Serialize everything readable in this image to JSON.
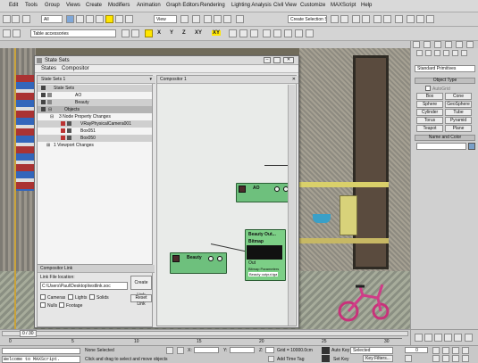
{
  "menu": [
    "Edit",
    "Tools",
    "Group",
    "Views",
    "Create",
    "Modifiers",
    "Animation",
    "Graph Editors",
    "Rendering",
    "Lighting Analysis",
    "Civil View",
    "Customize",
    "MAXScript",
    "Help"
  ],
  "toolbar": {
    "selection_filter": "All",
    "ref_coord": "View",
    "named_selection": "Create Selection Se",
    "layer": "Table accessories",
    "axes": [
      "X",
      "Y",
      "Z",
      "XY",
      "XY"
    ]
  },
  "state_sets": {
    "title": "State Sets",
    "menu": [
      "States",
      "Compositor"
    ],
    "tree_header": "State Sets 1",
    "rows": [
      {
        "label": "State Sets",
        "level": 0
      },
      {
        "label": "AO",
        "level": 1
      },
      {
        "label": "Beauty",
        "level": 1
      },
      {
        "label": "Objects",
        "level": 1
      },
      {
        "label": "3 Node Property Changes",
        "level": 2
      },
      {
        "label": "VRayPhysicalCamera001",
        "level": 3
      },
      {
        "label": "Box051",
        "level": 3
      },
      {
        "label": "Box050",
        "level": 3
      },
      {
        "label": "1 Viewport Changes",
        "level": 2
      }
    ],
    "compositor_header": "Compositor 1",
    "nodes": [
      {
        "title": "AO"
      },
      {
        "title": "Beauty"
      },
      {
        "title": "Beauty Out...",
        "subtitle": "Bitmap",
        "rows": [
          "Out",
          "Bitmap Parameters",
          "Beauty  output.tga"
        ]
      }
    ],
    "link_panel": {
      "header": "Compositor Link",
      "file_location_label": "Link File location:",
      "file_path": "C:\\Users\\Paul\\Desktop\\testlink.soc",
      "create_button": "Create Link",
      "reset_button": "Reset Link",
      "options": [
        "Cameras",
        "Lights",
        "Solids",
        "Nulls",
        "Footage"
      ]
    }
  },
  "command_panel": {
    "dropdown": "Standard Primitives",
    "object_type_header": "Object Type",
    "autogrid": "AutoGrid",
    "buttons": [
      "Box",
      "Cone",
      "Sphere",
      "GeoSphere",
      "Cylinder",
      "Tube",
      "Torus",
      "Pyramid",
      "Teapot",
      "Plane"
    ],
    "name_color_header": "Name and Color"
  },
  "timeline": {
    "frame_indicator": "0 / 30",
    "ticks": [
      "0",
      "5",
      "10",
      "15",
      "20",
      "25",
      "30"
    ]
  },
  "status": {
    "script_listener": "Welcome to MAXScript.",
    "selection": "None Selected",
    "prompt": "Click and drag to select and move objects",
    "x_label": "X:",
    "y_label": "Y:",
    "z_label": "Z:",
    "grid": "Grid = 10000.0cm",
    "add_time_tag": "Add Time Tag",
    "auto_key": "Auto Key",
    "set_key": "Set Key",
    "key_mode": "Selected",
    "key_filters": "Key Filters...",
    "frame": "0"
  }
}
